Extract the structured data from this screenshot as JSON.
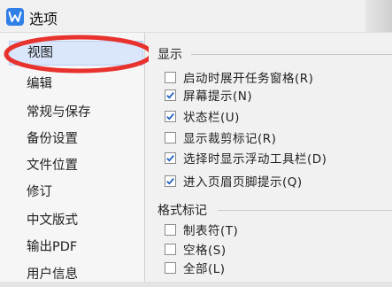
{
  "window": {
    "title": "选项",
    "icon": "wps-w-icon"
  },
  "sidebar": {
    "items": [
      {
        "label": "视图",
        "selected": true
      },
      {
        "label": "编辑",
        "selected": false
      },
      {
        "label": "常规与保存",
        "selected": false
      },
      {
        "label": "备份设置",
        "selected": false
      },
      {
        "label": "文件位置",
        "selected": false
      },
      {
        "label": "修订",
        "selected": false
      },
      {
        "label": "中文版式",
        "selected": false
      },
      {
        "label": "输出PDF",
        "selected": false
      },
      {
        "label": "用户信息",
        "selected": false
      }
    ]
  },
  "display_group": {
    "title": "显示",
    "options": [
      {
        "label": "启动时展开任务窗格(R)",
        "checked": false
      },
      {
        "label": "屏幕提示(N)",
        "checked": true
      },
      {
        "label": "状态栏(U)",
        "checked": true
      },
      {
        "label": "显示裁剪标记(R)",
        "checked": false
      },
      {
        "label": "选择时显示浮动工具栏(D)",
        "checked": true
      },
      {
        "label": "进入页眉页脚提示(Q)",
        "checked": true
      }
    ]
  },
  "format_marks_group": {
    "title": "格式标记",
    "options": [
      {
        "label": "制表符(T)",
        "checked": false
      },
      {
        "label": "空格(S)",
        "checked": false
      },
      {
        "label": "全部(L)",
        "checked": false
      }
    ]
  },
  "colors": {
    "accent": "#2f7fe6",
    "annotation": "#e8322e",
    "selection": "#d9e6fb"
  }
}
